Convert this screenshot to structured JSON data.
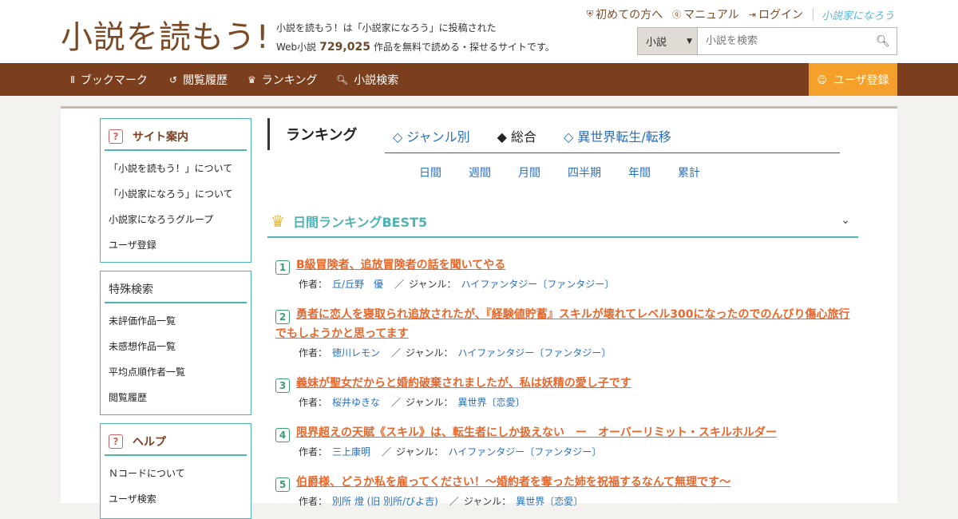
{
  "header": {
    "logo": "小説を読もう!",
    "tagline1": "小説を読もう！は「小説家になろう」に投稿された",
    "tagline2_pre": "Web小説",
    "work_count": "729,025",
    "tagline2_post": "作品を無料で読める・探せるサイトです。",
    "links": [
      "初めての方へ",
      "マニュアル",
      "ログイン"
    ],
    "brand": "小説家になろう",
    "search_select": "小説",
    "search_placeholder": "小説を検索"
  },
  "nav": {
    "items": [
      "ブックマーク",
      "閲覧履歴",
      "ランキング",
      "小説検索"
    ],
    "register": "ユーザ登録"
  },
  "sidebar": {
    "site_guide": {
      "title": "サイト案内",
      "items": [
        "「小説を読もう！」について",
        "「小説家になろう」について",
        "小説家になろうグループ",
        "ユーザ登録"
      ]
    },
    "special_search": {
      "title": "特殊検索",
      "items": [
        "未評価作品一覧",
        "未感想作品一覧",
        "平均点順作者一覧",
        "閲覧履歴"
      ]
    },
    "help": {
      "title": "ヘルプ",
      "items": [
        "Ｎコードについて",
        "ユーザ検索"
      ]
    }
  },
  "ranking": {
    "heading": "ランキング",
    "tabs": [
      "◇ ジャンル別",
      "◆ 総合",
      "◇ 異世界転生/転移"
    ],
    "periods": [
      "日間",
      "週間",
      "月間",
      "四半期",
      "年間",
      "累計"
    ],
    "best_title": "日間ランキングBEST5",
    "author_label": "作者：",
    "genre_label": "ジャンル：",
    "entries": [
      {
        "rank": "1",
        "title": "B級冒険者、追放冒険者の話を聞いてやる",
        "author": "丘/丘野　優",
        "genre": "ハイファンタジー〔ファンタジー〕"
      },
      {
        "rank": "2",
        "title": "勇者に恋人を寝取られ追放されたが、『経験値貯蓄』スキルが壊れてレベル300になったのでのんびり傷心旅行でもしようかと思ってます",
        "author": "徳川レモン",
        "genre": "ハイファンタジー〔ファンタジー〕"
      },
      {
        "rank": "3",
        "title": "義妹が聖女だからと婚約破棄されましたが、私は妖精の愛し子です",
        "author": "桜井ゆきな",
        "genre": "異世界〔恋愛〕"
      },
      {
        "rank": "4",
        "title": "限界超えの天賦《スキル》は、転生者にしか扱えない　ー　オーバーリミット・スキルホルダー",
        "author": "三上康明",
        "genre": "ハイファンタジー〔ファンタジー〕"
      },
      {
        "rank": "5",
        "title": "伯爵様、どうか私を雇ってください！～婚約者を奪った姉を祝福するなんて無理です～",
        "author": "別所 燈 (旧 別所/びよ吉)",
        "genre": "異世界〔恋愛〕"
      }
    ]
  }
}
